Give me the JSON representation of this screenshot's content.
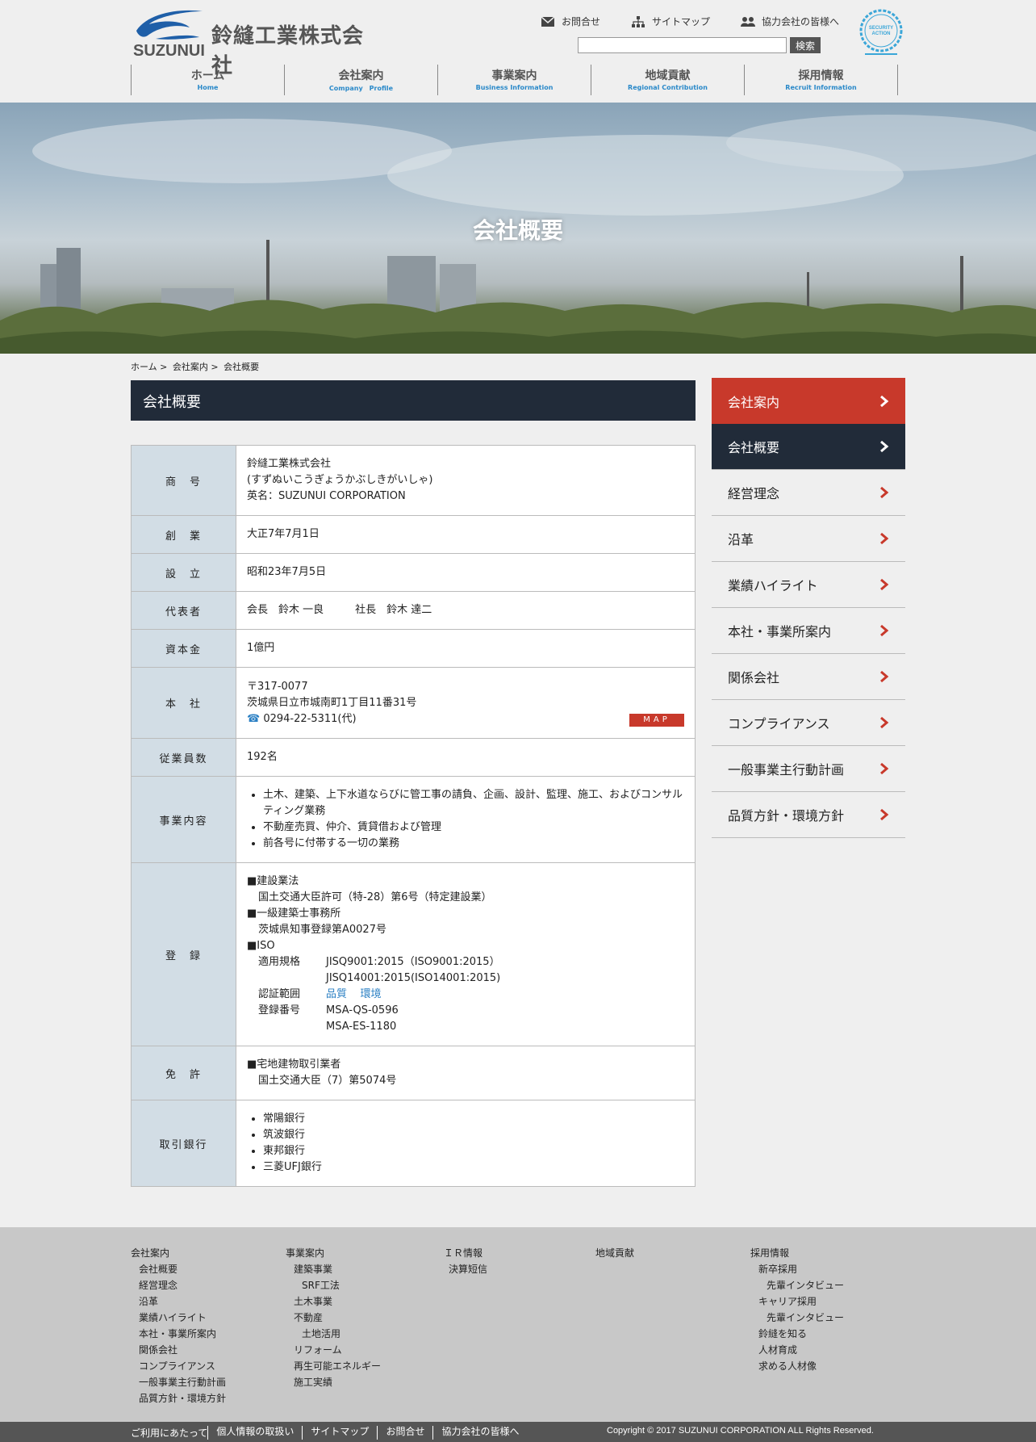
{
  "header": {
    "company_name": "鈴縫工業株式会社",
    "company_en": "SUZUNUI",
    "util_links": [
      "お問合せ",
      "サイトマップ",
      "協力会社の皆様へ"
    ],
    "search_placeholder": "",
    "search_button": "検索",
    "badge_text": "SECURITY ACTION",
    "nav": [
      {
        "jp": "ホーム",
        "en": "Home"
      },
      {
        "jp": "会社案内",
        "en": "Company　Profile"
      },
      {
        "jp": "事業案内",
        "en": "Business Information"
      },
      {
        "jp": "地域貢献",
        "en": "Regional Contribution"
      },
      {
        "jp": "採用情報",
        "en": "Recruit Information"
      }
    ]
  },
  "hero": {
    "title": "会社概要"
  },
  "breadcrumb": [
    "ホーム",
    ">",
    "会社案内",
    ">",
    "会社概要"
  ],
  "page_heading": "会社概要",
  "table": {
    "shogo_label": "商　号",
    "shogo": [
      "鈴縫工業株式会社",
      "(すずぬいこうぎょうかぶしきがいしゃ)",
      "英名：SUZUNUI CORPORATION"
    ],
    "sogyo_label": "創　業",
    "sogyo": "大正7年7月1日",
    "setsuritsu_label": "設　立",
    "setsuritsu": "昭和23年7月5日",
    "daihyo_label": "代表者",
    "daihyo": "会長　鈴木 一良　　　社長　鈴木 達二",
    "shihon_label": "資本金",
    "shihon": "1億円",
    "honsha_label": "本　社",
    "honsha_zip": "〒317-0077",
    "honsha_addr": "茨城県日立市城南町1丁目11番31号",
    "honsha_tel": "0294-22-5311(代)",
    "map_button": "MAP",
    "jugyoin_label": "従業員数",
    "jugyoin": "192名",
    "jigyo_label": "事業内容",
    "jigyo": [
      "土木、建築、上下水道ならびに管工事の請負、企画、設計、監理、施工、およびコンサルティング業務",
      "不動産売買、仲介、賃貸借および管理",
      "前各号に付帯する一切の業務"
    ],
    "toroku_label": "登　録",
    "toroku_kensetsu": "■建設業法",
    "toroku_kensetsu_detail": "国土交通大臣許可（特-28）第6号（特定建設業）",
    "toroku_kenchiku": "■一級建築士事務所",
    "toroku_kenchiku_detail": "茨城県知事登録第A0027号",
    "toroku_iso": "■ISO",
    "iso_kikaku_label": "適用規格",
    "iso_kikaku_1": "JISQ9001:2015（ISO9001:2015）",
    "iso_kikaku_2": "JISQ14001:2015(ISO14001:2015)",
    "iso_hani_label": "認証範囲",
    "iso_hani_links": [
      "品質",
      "環境"
    ],
    "iso_bango_label": "登録番号",
    "iso_bango_1": "MSA-QS-0596",
    "iso_bango_2": "MSA-ES-1180",
    "menkyo_label": "免　許",
    "menkyo": "■宅地建物取引業者",
    "menkyo_detail": "国土交通大臣（7）第5074号",
    "ginko_label": "取引銀行",
    "ginko": [
      "常陽銀行",
      "筑波銀行",
      "東邦銀行",
      "三菱UFJ銀行"
    ]
  },
  "sidebar": [
    {
      "label": "会社案内",
      "state": "red"
    },
    {
      "label": "会社概要",
      "state": "dark"
    },
    {
      "label": "経営理念",
      "state": ""
    },
    {
      "label": "沿革",
      "state": ""
    },
    {
      "label": "業績ハイライト",
      "state": ""
    },
    {
      "label": "本社・事業所案内",
      "state": ""
    },
    {
      "label": "関係会社",
      "state": ""
    },
    {
      "label": "コンプライアンス",
      "state": ""
    },
    {
      "label": "一般事業主行動計画",
      "state": ""
    },
    {
      "label": "品質方針・環境方針",
      "state": ""
    }
  ],
  "footer": {
    "col1": {
      "title": "会社案内",
      "items": [
        "会社概要",
        "経営理念",
        "沿革",
        "業績ハイライト",
        "本社・事業所案内",
        "関係会社",
        "コンプライアンス",
        "一般事業主行動計画",
        "品質方針・環境方針"
      ]
    },
    "col2": {
      "title": "事業案内",
      "items": [
        [
          "建築事業",
          1
        ],
        [
          "SRF工法",
          2
        ],
        [
          "土木事業",
          1
        ],
        [
          "不動産",
          1
        ],
        [
          "土地活用",
          2
        ],
        [
          "リフォーム",
          1
        ],
        [
          "再生可能エネルギー",
          1
        ],
        [
          "施工実績",
          1
        ]
      ]
    },
    "col3": {
      "title": "ＩＲ情報",
      "items": [
        "決算短信"
      ]
    },
    "col4": {
      "title": "地域貢献",
      "items": []
    },
    "col5": {
      "title": "採用情報",
      "items": [
        [
          "新卒採用",
          1
        ],
        [
          "先輩インタビュー",
          2
        ],
        [
          "キャリア採用",
          1
        ],
        [
          "先輩インタビュー",
          2
        ],
        [
          "鈴縫を知る",
          1
        ],
        [
          "人材育成",
          1
        ],
        [
          "求める人材像",
          1
        ]
      ]
    },
    "bottom_links": [
      "ご利用にあたって",
      "個人情報の取扱い",
      "サイトマップ",
      "お問合せ",
      "協力会社の皆様へ"
    ],
    "copyright": "Copyright © 2017 SUZUNUI CORPORATION ALL Rights Reserved."
  }
}
